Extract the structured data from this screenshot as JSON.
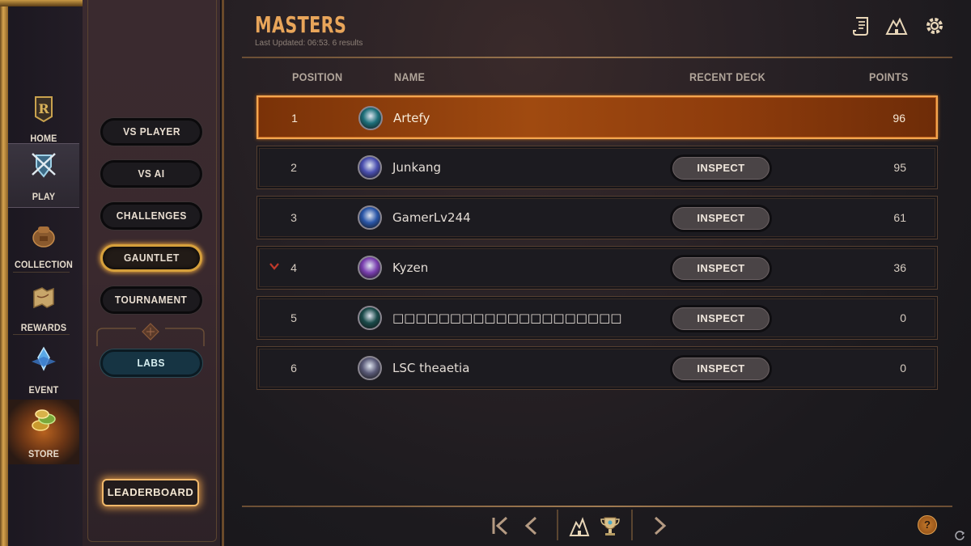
{
  "nav": {
    "items": [
      {
        "label": "HOME",
        "icon": "rune-logo-icon"
      },
      {
        "label": "PLAY",
        "icon": "crossed-swords-shield-icon",
        "active": true
      },
      {
        "label": "COLLECTION",
        "icon": "backpack-icon"
      },
      {
        "label": "REWARDS",
        "icon": "map-scroll-icon"
      },
      {
        "label": "EVENT",
        "icon": "crystal-icon"
      },
      {
        "label": "STORE",
        "icon": "coins-icon"
      }
    ]
  },
  "play_menu": {
    "items": [
      "VS PLAYER",
      "VS AI",
      "CHALLENGES",
      "GAUNTLET",
      "TOURNAMENT",
      "LABS"
    ],
    "leaderboard_label": "LEADERBOARD"
  },
  "leaderboard": {
    "title": "MASTERS",
    "updated": "Last Updated: 06:53. 6 results",
    "columns": {
      "position": "POSITION",
      "name": "NAME",
      "recent_deck": "RECENT DECK",
      "points": "POINTS"
    },
    "inspect_label": "INSPECT",
    "rows": [
      {
        "position": "1",
        "name": "Artefy",
        "points": "96",
        "avatar_color": "#1d6f7a",
        "has_inspect": false,
        "rank_change": ""
      },
      {
        "position": "2",
        "name": "Junkang",
        "points": "95",
        "avatar_color": "#4a4fb0",
        "has_inspect": true,
        "rank_change": ""
      },
      {
        "position": "3",
        "name": "GamerLv244",
        "points": "61",
        "avatar_color": "#2a56a8",
        "has_inspect": true,
        "rank_change": ""
      },
      {
        "position": "4",
        "name": "Kyzen",
        "points": "36",
        "avatar_color": "#7a3fb0",
        "has_inspect": true,
        "rank_change": "down"
      },
      {
        "position": "5",
        "name": "□□□□□□□□□□□□□□□□□□□□",
        "points": "0",
        "avatar_color": "#1a4a4a",
        "has_inspect": true,
        "rank_change": ""
      },
      {
        "position": "6",
        "name": "LSC theaetia",
        "points": "0",
        "avatar_color": "#5a5a78",
        "has_inspect": true,
        "rank_change": ""
      }
    ]
  },
  "pager": {
    "help_label": "?"
  },
  "colors": {
    "accent": "#e8a55a",
    "highlight_row": "#a04a10",
    "labs": "#163443"
  }
}
